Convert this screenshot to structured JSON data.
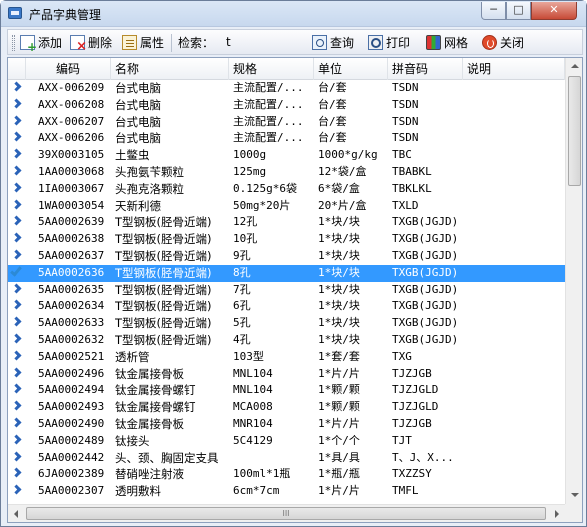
{
  "window": {
    "title": "产品字典管理",
    "min_glyph": "─",
    "max_glyph": "□",
    "close_glyph": "✕"
  },
  "toolbar": {
    "add_label": "添加",
    "delete_label": "删除",
    "properties_label": "属性",
    "search_label": "检索：",
    "search_value": "t",
    "query_label": "查询",
    "print_label": "打印",
    "grid_label": "网格",
    "close_label": "关闭"
  },
  "grid": {
    "columns": [
      "编码",
      "名称",
      "规格",
      "单位",
      "拼音码",
      "说明"
    ],
    "selected_row": 11,
    "rows": [
      [
        "AXX-006209",
        "台式电脑",
        "主流配置/...",
        "台/套",
        "TSDN",
        ""
      ],
      [
        "AXX-006208",
        "台式电脑",
        "主流配置/...",
        "台/套",
        "TSDN",
        ""
      ],
      [
        "AXX-006207",
        "台式电脑",
        "主流配置/...",
        "台/套",
        "TSDN",
        ""
      ],
      [
        "AXX-006206",
        "台式电脑",
        "主流配置/...",
        "台/套",
        "TSDN",
        ""
      ],
      [
        "39X0003105",
        "土鳖虫",
        "1000g",
        "1000*g/kg",
        "TBC",
        ""
      ],
      [
        "1AA0003068",
        "头孢氨苄颗粒",
        "125mg",
        "12*袋/盒",
        "TBABKL",
        ""
      ],
      [
        "1IA0003067",
        "头孢克洛颗粒",
        "0.125g*6袋",
        "6*袋/盒",
        "TBKLKL",
        ""
      ],
      [
        "1WA0003054",
        "天新利德",
        "50mg*20片",
        "20*片/盒",
        "TXLD",
        ""
      ],
      [
        "5AA0002639",
        "T型钢板(胫骨近端)",
        "12孔",
        "1*块/块",
        "TXGB(JGJD)",
        ""
      ],
      [
        "5AA0002638",
        "T型钢板(胫骨近端)",
        "10孔",
        "1*块/块",
        "TXGB(JGJD)",
        ""
      ],
      [
        "5AA0002637",
        "T型钢板(胫骨近端)",
        "9孔",
        "1*块/块",
        "TXGB(JGJD)",
        ""
      ],
      [
        "5AA0002636",
        "T型钢板(胫骨近端)",
        "8孔",
        "1*块/块",
        "TXGB(JGJD)",
        ""
      ],
      [
        "5AA0002635",
        "T型钢板(胫骨近端)",
        "7孔",
        "1*块/块",
        "TXGB(JGJD)",
        ""
      ],
      [
        "5AA0002634",
        "T型钢板(胫骨近端)",
        "6孔",
        "1*块/块",
        "TXGB(JGJD)",
        ""
      ],
      [
        "5AA0002633",
        "T型钢板(胫骨近端)",
        "5孔",
        "1*块/块",
        "TXGB(JGJD)",
        ""
      ],
      [
        "5AA0002632",
        "T型钢板(胫骨近端)",
        "4孔",
        "1*块/块",
        "TXGB(JGJD)",
        ""
      ],
      [
        "5AA0002521",
        "透析管",
        "103型",
        "1*套/套",
        "TXG",
        ""
      ],
      [
        "5AA0002496",
        "钛金属接骨板",
        "MNL104",
        "1*片/片",
        "TJZJGB",
        ""
      ],
      [
        "5AA0002494",
        "钛金属接骨螺钉",
        "MNL104",
        "1*颗/颗",
        "TJZJGLD",
        ""
      ],
      [
        "5AA0002493",
        "钛金属接骨螺钉",
        "MCA008",
        "1*颗/颗",
        "TJZJGLD",
        ""
      ],
      [
        "5AA0002490",
        "钛金属接骨板",
        "MNR104",
        "1*片/片",
        "TJZJGB",
        ""
      ],
      [
        "5AA0002489",
        "钛接头",
        "5C4129",
        "1*个/个",
        "TJT",
        ""
      ],
      [
        "5AA0002442",
        "头、颈、胸固定支具",
        "",
        "1*具/具",
        "T、J、X...",
        ""
      ],
      [
        "6JA0002389",
        "替硝唑注射液",
        "100ml*1瓶",
        "1*瓶/瓶",
        "TXZZSY",
        ""
      ],
      [
        "5AA0002307",
        "透明敷料",
        "6cm*7cm",
        "1*片/片",
        "TMFL",
        ""
      ]
    ]
  },
  "scrollbar": {
    "h_thumb_grip": "III"
  },
  "icons": {
    "row_indicator": "chevron-right-icon",
    "selected_indicator": "checkmark-icon"
  }
}
